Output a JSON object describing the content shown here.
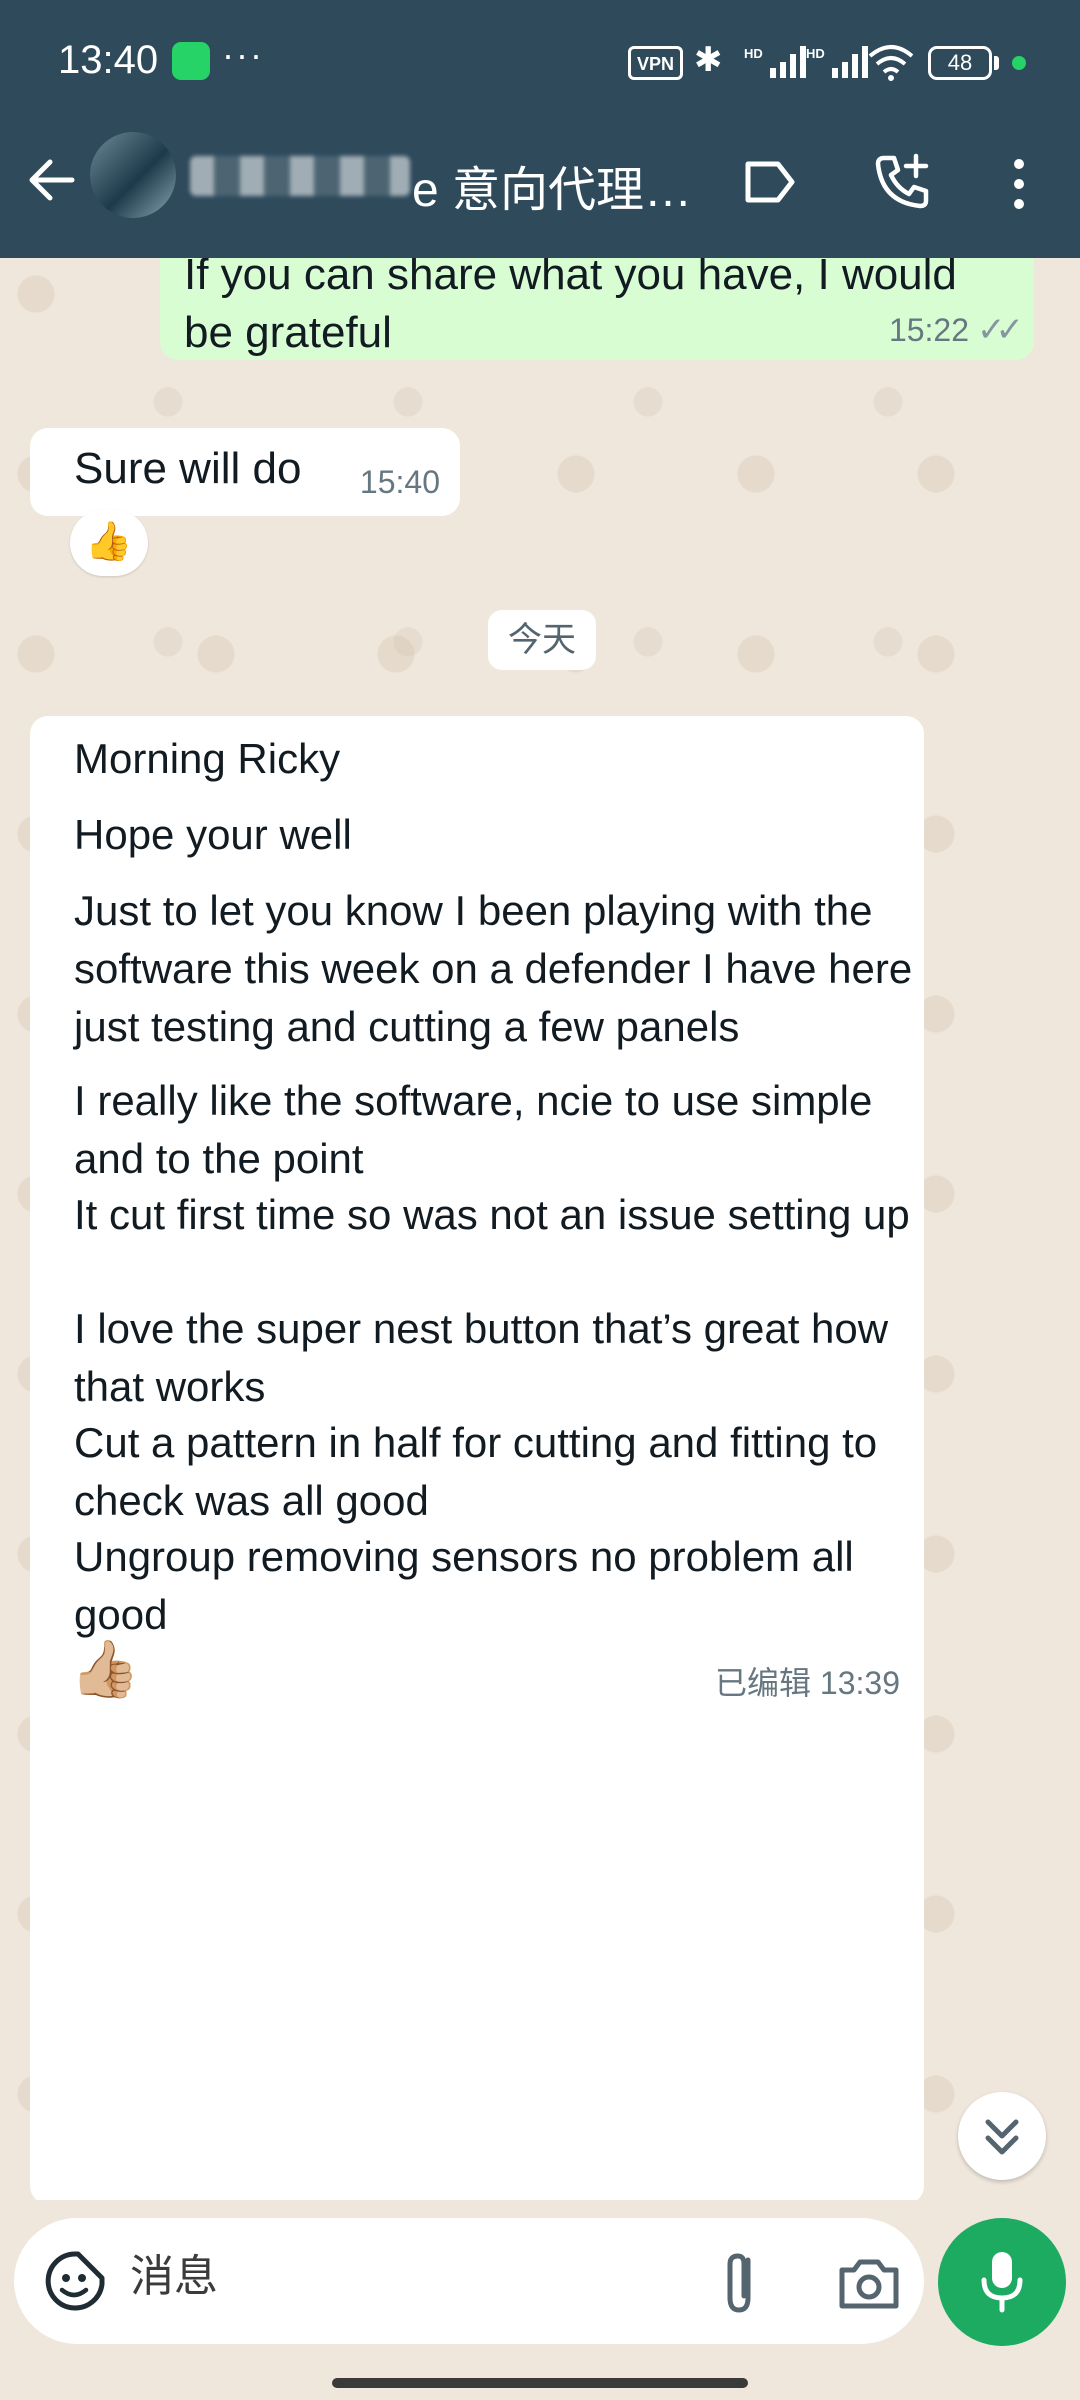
{
  "status_bar": {
    "time": "13:40",
    "dots": "···",
    "vpn": "VPN",
    "battery": "48",
    "icons": [
      "whatsapp-icon",
      "bluetooth-icon",
      "signal-hd-icon",
      "signal-hd-icon",
      "wifi-icon",
      "battery-icon"
    ]
  },
  "header": {
    "title": "e 意向代理…",
    "icons": [
      "back-arrow-icon",
      "label-icon",
      "add-call-icon",
      "more-vert-icon"
    ]
  },
  "messages": [
    {
      "direction": "outgoing",
      "text": "If you can share what you have, I would be grateful",
      "time": "15:22",
      "status": "read"
    },
    {
      "direction": "incoming",
      "text": "Sure will do",
      "time": "15:40",
      "reaction": "👍"
    },
    {
      "type": "date",
      "label": "今天"
    },
    {
      "direction": "incoming",
      "paragraphs": [
        "Morning Ricky",
        "Hope your well",
        "Just to let you know I been playing with the software this week on a defender I have here just testing and cutting a few panels",
        "I really like the software, ncie to use simple and to the point",
        "It cut first time so was not an issue setting up",
        "I love the super nest button that’s great how that works",
        "Cut a pattern in half for cutting and fitting to check was all good",
        "Ungroup removing sensors no problem all good"
      ],
      "reaction": "👍🏼",
      "edited_label": "已编辑",
      "time": "13:39"
    }
  ],
  "composer": {
    "placeholder": "消息",
    "icons": [
      "sticker-emoji-icon",
      "attach-icon",
      "camera-icon",
      "mic-icon"
    ]
  },
  "colors": {
    "header_bg": "#2e4a5b",
    "chat_bg": "#efe7dc",
    "outgoing_bubble": "#d9fdd3",
    "incoming_bubble": "#ffffff",
    "accent_green": "#1daa61"
  }
}
